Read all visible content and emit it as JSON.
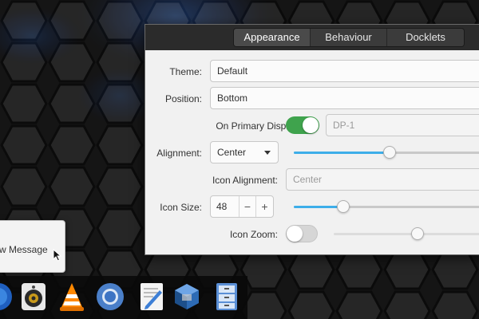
{
  "window": {
    "tabs": [
      {
        "label": "Appearance",
        "active": true
      },
      {
        "label": "Behaviour",
        "active": false
      },
      {
        "label": "Docklets",
        "active": false
      }
    ],
    "theme": {
      "label": "Theme:",
      "value": "Default"
    },
    "position": {
      "label": "Position:",
      "value": "Bottom"
    },
    "primary_display": {
      "label": "On Primary Display:",
      "enabled": true,
      "display_value": "DP-1"
    },
    "alignment": {
      "label": "Alignment:",
      "value": "Center",
      "offset_level": 0.5
    },
    "icon_alignment": {
      "label": "Icon Alignment:",
      "placeholder": "Center"
    },
    "icon_size": {
      "label": "Icon Size:",
      "value": "48",
      "minus": "−",
      "plus": "+",
      "level": 0.26
    },
    "icon_zoom": {
      "label": "Icon Zoom:",
      "enabled": false,
      "level": 0.55
    }
  },
  "popup_menu": {
    "item": "w Message"
  },
  "dock": {
    "items": [
      {
        "name": "browser-icon"
      },
      {
        "name": "speaker-icon"
      },
      {
        "name": "vlc-icon"
      },
      {
        "name": "chromium-icon"
      },
      {
        "name": "text-editor-icon"
      },
      {
        "name": "virtualbox-icon"
      },
      {
        "name": "file-cabinet-icon"
      }
    ]
  },
  "colors": {
    "accent": "#3daee9",
    "switch_on": "#3fa34d",
    "wallpaper_glow": "#1e6fff"
  }
}
